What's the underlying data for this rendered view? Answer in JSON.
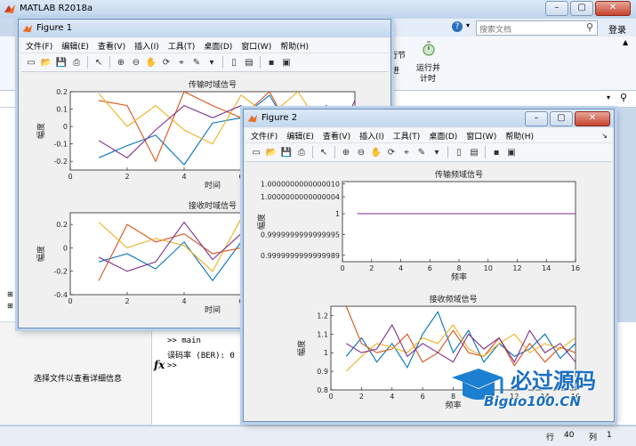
{
  "matlab": {
    "title": "MATLAB R2018a",
    "search_placeholder": "搜索文档",
    "login": "登录",
    "ribbon_btn1": "行节",
    "ribbon_btn2": "进",
    "run_label1": "运行并",
    "run_label2": "计时",
    "file_hint": "选择文件以查看详细信息",
    "cmd_line1": ">> main",
    "cmd_line2": "误码率 (BER): 0",
    "prompt": ">>",
    "fx": "fx",
    "status_row_label": "行",
    "status_row_value": "40",
    "status_col_label": "列",
    "status_col_value": "1"
  },
  "figure1": {
    "title": "Figure 1",
    "menus": [
      "文件(F)",
      "编辑(E)",
      "查看(V)",
      "插入(I)",
      "工具(T)",
      "桌面(D)",
      "窗口(W)",
      "帮助(H)"
    ]
  },
  "figure2": {
    "title": "Figure 2",
    "menus": [
      "文件(F)",
      "编辑(E)",
      "查看(V)",
      "插入(I)",
      "工具(T)",
      "桌面(D)",
      "窗口(W)",
      "帮助(H)"
    ]
  },
  "watermark": {
    "line1": "必过源码",
    "line2": "Biguo100.CN"
  },
  "colors": [
    "#0072BD",
    "#D95319",
    "#EDB120",
    "#7E2F8E"
  ],
  "chart_data": [
    {
      "id": "tx_time",
      "type": "line",
      "title": "传输时域信号",
      "xlabel": "时间",
      "ylabel": "幅度",
      "xlim": [
        0,
        10
      ],
      "ylim": [
        -0.25,
        0.2
      ],
      "xticks": [
        0,
        2,
        4,
        6,
        8,
        10
      ],
      "yticks": [
        -0.2,
        -0.1,
        0,
        0.1,
        0.2
      ],
      "ytick_labels": [
        "-0.2",
        "-0.1",
        "0",
        "0.1",
        "0.2"
      ],
      "x": [
        1,
        2,
        3,
        4,
        5,
        6,
        7,
        8,
        9,
        10
      ],
      "series": [
        {
          "values": [
            -0.18,
            -0.11,
            -0.05,
            -0.22,
            0.02,
            0.05,
            0.18,
            -0.1,
            0.12,
            -0.2
          ]
        },
        {
          "values": [
            0.15,
            0.12,
            -0.2,
            0.2,
            0.12,
            0.05,
            0.2,
            -0.1,
            0.1,
            0.05
          ]
        },
        {
          "values": [
            0.19,
            0.0,
            0.12,
            -0.02,
            -0.1,
            0.18,
            0.06,
            0.2,
            -0.05,
            0.02
          ]
        },
        {
          "values": [
            -0.08,
            -0.18,
            -0.02,
            0.12,
            0.05,
            0.12,
            -0.1,
            0.02,
            -0.2,
            0.15
          ]
        }
      ]
    },
    {
      "id": "rx_time",
      "type": "line",
      "title": "接收时域信号",
      "xlabel": "时间",
      "ylabel": "幅度",
      "xlim": [
        0,
        10
      ],
      "ylim": [
        -0.4,
        0.3
      ],
      "xticks": [
        0,
        2,
        4,
        6,
        8,
        10
      ],
      "yticks": [
        -0.4,
        -0.2,
        0,
        0.2
      ],
      "ytick_labels": [
        "-0.4",
        "-0.2",
        "0",
        "0.2"
      ],
      "x": [
        1,
        2,
        3,
        4,
        5,
        6,
        7,
        8,
        9,
        10
      ],
      "series": [
        {
          "values": [
            -0.12,
            -0.05,
            -0.18,
            0.05,
            -0.28,
            0.05,
            0.15,
            -0.2,
            0.1,
            -0.25
          ]
        },
        {
          "values": [
            -0.28,
            0.2,
            0.05,
            0.12,
            -0.05,
            0.0,
            0.28,
            -0.1,
            0.15,
            0.0
          ]
        },
        {
          "values": [
            0.22,
            0.0,
            0.08,
            0.02,
            -0.2,
            0.25,
            0.05,
            0.15,
            -0.08,
            0.05
          ]
        },
        {
          "values": [
            -0.08,
            -0.2,
            -0.12,
            0.22,
            -0.1,
            0.12,
            -0.18,
            0.05,
            -0.3,
            0.2
          ]
        }
      ]
    },
    {
      "id": "tx_freq",
      "type": "line",
      "title": "传输频域信号",
      "xlabel": "频率",
      "ylabel": "幅度",
      "xlim": [
        0,
        16
      ],
      "ylim": [
        0.9999999999999984,
        1.000000000000001
      ],
      "xticks": [
        0,
        2,
        4,
        6,
        8,
        10,
        12,
        14,
        16
      ],
      "yticks": [
        0.9999999999999989,
        0.9999999999999994,
        1,
        1.0000000000000004,
        1.000000000000001
      ],
      "ytick_labels": [
        "0.9999999999999989",
        "0.9999999999999995",
        "1",
        "1.0000000000000004",
        "1.0000000000000010"
      ],
      "ytick_fractions": [
        0.08,
        0.34,
        0.6,
        0.81,
        0.97
      ],
      "x": [
        1,
        2,
        3,
        4,
        5,
        6,
        7,
        8,
        9,
        10,
        11,
        12,
        13,
        14,
        15,
        16
      ],
      "series": [
        {
          "values": [
            1,
            1,
            1,
            1,
            1,
            1,
            1,
            1,
            1,
            1,
            1,
            1,
            1,
            1,
            1,
            1
          ]
        }
      ]
    },
    {
      "id": "rx_freq",
      "type": "line",
      "title": "接收频域信号",
      "xlabel": "频率",
      "ylabel": "幅度",
      "xlim": [
        0,
        16
      ],
      "ylim": [
        0.8,
        1.25
      ],
      "xticks": [
        0,
        2,
        4,
        6,
        8,
        10,
        12,
        14,
        16
      ],
      "yticks": [
        0.8,
        0.9,
        1,
        1.1,
        1.2
      ],
      "ytick_labels": [
        "0.8",
        "0.9",
        "1",
        "1.1",
        "1.2"
      ],
      "x": [
        1,
        2,
        3,
        4,
        5,
        6,
        7,
        8,
        9,
        10,
        11,
        12,
        13,
        14,
        15,
        16
      ],
      "series": [
        {
          "values": [
            0.98,
            1.08,
            0.95,
            1.05,
            0.92,
            1.1,
            1.22,
            1.0,
            1.12,
            0.95,
            1.05,
            0.98,
            1.02,
            1.1,
            0.97,
            1.05
          ]
        },
        {
          "values": [
            1.25,
            1.05,
            1.0,
            1.02,
            1.1,
            0.95,
            1.0,
            1.12,
            1.0,
            0.98,
            1.08,
            0.93,
            1.05,
            0.95,
            1.03,
            1.0
          ]
        },
        {
          "values": [
            0.9,
            0.98,
            1.05,
            1.03,
            1.0,
            1.08,
            1.05,
            1.15,
            1.02,
            0.98,
            1.05,
            1.1,
            1.0,
            1.05,
            1.02,
            1.08
          ]
        },
        {
          "values": [
            1.05,
            1.0,
            1.02,
            1.15,
            0.98,
            1.05,
            1.0,
            0.95,
            1.1,
            1.02,
            1.08,
            0.95,
            1.12,
            1.0,
            1.05,
            0.95
          ]
        }
      ]
    }
  ]
}
